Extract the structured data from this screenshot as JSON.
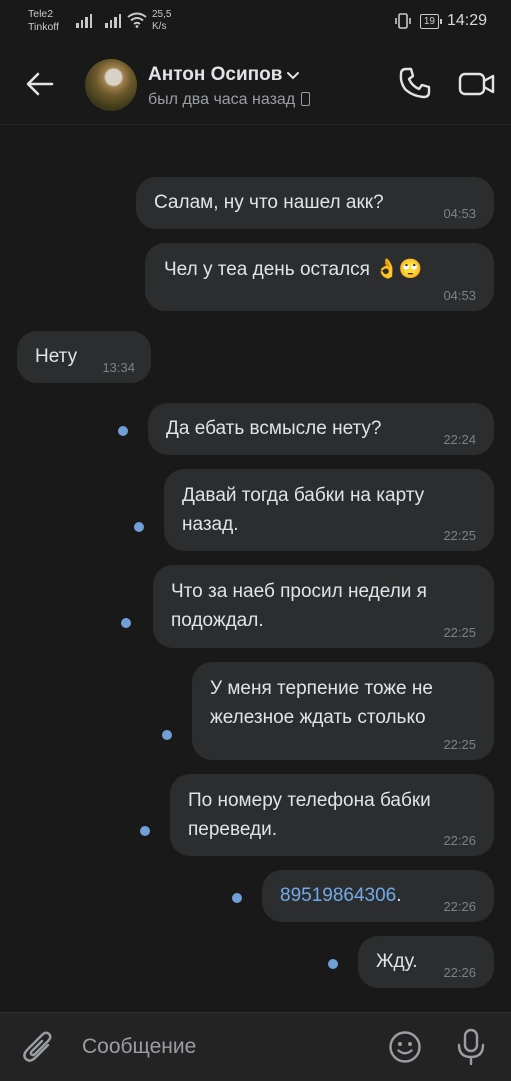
{
  "status_bar": {
    "carrier1": "Tele2",
    "carrier2": "Tinkoff",
    "speed_value": "25,5",
    "speed_unit": "K/s",
    "battery": "19",
    "time": "14:29"
  },
  "header": {
    "name": "Антон Осипов",
    "last_seen": "был два часа назад"
  },
  "messages": [
    {
      "text": "Салам, ну что нашел акк?",
      "time": "04:53",
      "from": "me"
    },
    {
      "text": "Чел у теа день остался 👌🙄",
      "time": "04:53",
      "from": "me"
    },
    {
      "text": "Нету",
      "time": "13:34",
      "from": "them"
    },
    {
      "text": "Да ебать всмысле нету?",
      "time": "22:24",
      "from": "me"
    },
    {
      "text": "Давай тогда бабки на карту назад.",
      "time": "22:25",
      "from": "me"
    },
    {
      "text": "Что за наеб просил недели я подождал.",
      "time": "22:25",
      "from": "me"
    },
    {
      "text": "У меня терпение тоже не железное ждать столько",
      "time": "22:25",
      "from": "me"
    },
    {
      "text": "По номеру телефона бабки переведи.",
      "time": "22:26",
      "from": "me"
    },
    {
      "link": "89519864306",
      "suffix": ".",
      "time": "22:26",
      "from": "me"
    },
    {
      "text": "Жду.",
      "time": "22:26",
      "from": "me"
    }
  ],
  "input": {
    "placeholder": "Сообщение"
  },
  "colors": {
    "background": "#191919",
    "bubble": "#2c2d2e",
    "unread_dot": "#719fd6",
    "link": "#71aaeb"
  },
  "icons": [
    "back-arrow-icon",
    "chevron-down-icon",
    "phone-icon",
    "video-call-icon",
    "attach-icon",
    "emoji-icon",
    "microphone-icon"
  ]
}
